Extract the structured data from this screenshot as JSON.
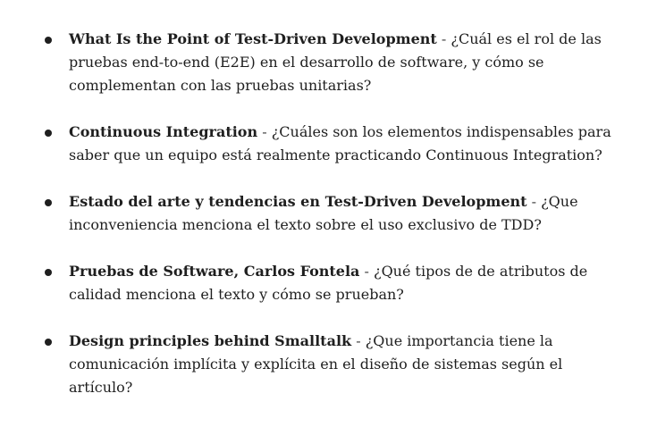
{
  "reading_list": {
    "separator": " - ",
    "items": [
      {
        "title": "What Is the Point of Test-Driven Development",
        "question": "¿Cuál es el rol de las pruebas end-to-end (E2E) en el desarrollo de software, y cómo se complementan con las pruebas unitarias?"
      },
      {
        "title": "Continuous Integration",
        "question": "¿Cuáles son los elementos indispensables para saber que un equipo está realmente practicando Continuous Integration?"
      },
      {
        "title": "Estado del arte y tendencias en Test-Driven Development",
        "question": "¿Que inconveniencia menciona el texto sobre el uso exclusivo de TDD?"
      },
      {
        "title": "Pruebas de Software, Carlos Fontela",
        "question": "¿Qué tipos de de atributos de calidad menciona el texto y cómo se prueban?"
      },
      {
        "title": "Design principles behind Smalltalk",
        "question": "¿Que importancia tiene la comunicación implícita y explícita en el diseño de sistemas según el artículo?"
      }
    ]
  }
}
